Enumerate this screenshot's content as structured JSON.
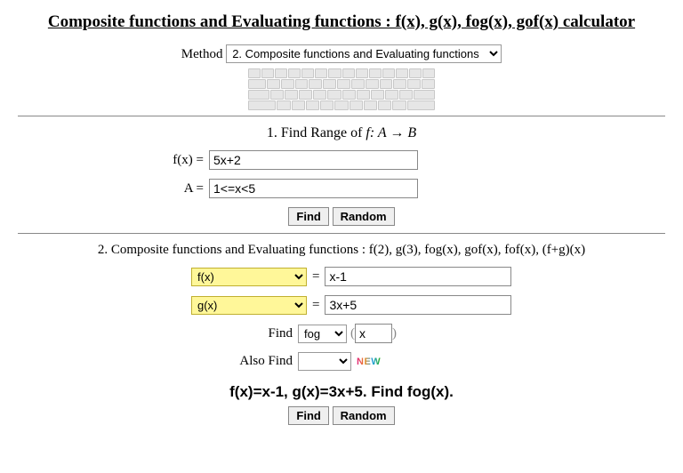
{
  "title": "Composite functions and Evaluating functions : f(x), g(x), fog(x), gof(x) calculator",
  "method": {
    "label": "Method",
    "selected": "2. Composite functions and Evaluating functions"
  },
  "section1": {
    "heading_prefix": "1. Find Range of ",
    "heading_math": "f: A → B",
    "fx_label": "f(x) = ",
    "fx_value": "5x+2",
    "a_label": "A = ",
    "a_value": "1<=x<5",
    "find_btn": "Find",
    "random_btn": "Random"
  },
  "section2": {
    "heading": "2. Composite functions and Evaluating functions : f(2), g(3), fog(x), gof(x), fof(x), (f+g)(x)",
    "fn1_selected": "f(x)",
    "fn1_value": "x-1",
    "fn2_selected": "g(x)",
    "fn2_value": "3x+5",
    "find_label": "Find",
    "op_selected": "fog",
    "arg_value": "x",
    "also_find_label": "Also Find",
    "also_find_selected": "",
    "new_badge": "NEW"
  },
  "result": "f(x)=x-1, g(x)=3x+5. Find fog(x).",
  "bottom": {
    "find_btn": "Find",
    "random_btn": "Random"
  }
}
